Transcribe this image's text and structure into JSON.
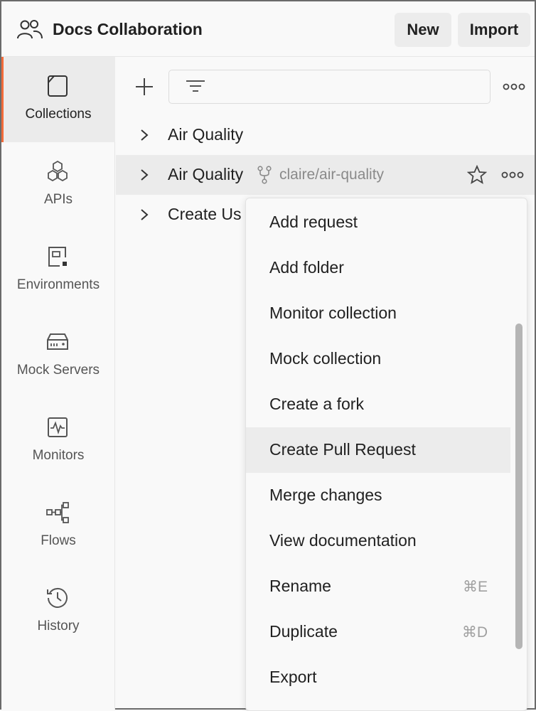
{
  "header": {
    "title": "Docs Collaboration",
    "new_label": "New",
    "import_label": "Import"
  },
  "sidebar": {
    "items": [
      {
        "label": "Collections",
        "icon": "collections-icon",
        "active": true
      },
      {
        "label": "APIs",
        "icon": "apis-icon",
        "active": false
      },
      {
        "label": "Environments",
        "icon": "environments-icon",
        "active": false
      },
      {
        "label": "Mock Servers",
        "icon": "mock-servers-icon",
        "active": false
      },
      {
        "label": "Monitors",
        "icon": "monitors-icon",
        "active": false
      },
      {
        "label": "Flows",
        "icon": "flows-icon",
        "active": false
      },
      {
        "label": "History",
        "icon": "history-icon",
        "active": false
      }
    ]
  },
  "collections": [
    {
      "name": "Air Quality"
    },
    {
      "name": "Air Quality",
      "fork": "claire/air-quality"
    },
    {
      "name": "Create Us"
    }
  ],
  "context_menu": {
    "items": [
      {
        "label": "Add request",
        "shortcut": ""
      },
      {
        "label": "Add folder",
        "shortcut": ""
      },
      {
        "label": "Monitor collection",
        "shortcut": ""
      },
      {
        "label": "Mock collection",
        "shortcut": ""
      },
      {
        "label": "Create a fork",
        "shortcut": ""
      },
      {
        "label": "Create Pull Request",
        "shortcut": ""
      },
      {
        "label": "Merge changes",
        "shortcut": ""
      },
      {
        "label": "View documentation",
        "shortcut": ""
      },
      {
        "label": "Rename",
        "shortcut": "⌘E"
      },
      {
        "label": "Duplicate",
        "shortcut": "⌘D"
      },
      {
        "label": "Export",
        "shortcut": ""
      }
    ],
    "hovered_index": 5
  },
  "colors": {
    "accent": "#f26b3a",
    "active_bg": "#ebebeb",
    "background": "#f9f9f9",
    "muted_text": "#8a8a8a"
  }
}
